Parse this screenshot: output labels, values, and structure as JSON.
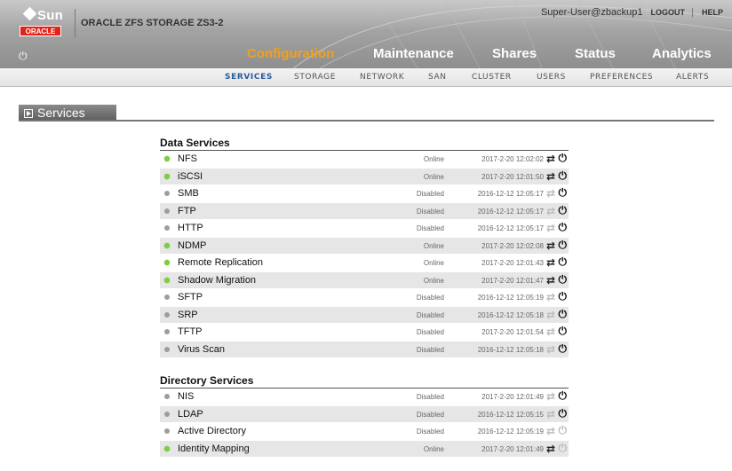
{
  "header": {
    "sun_logo": "Sun",
    "oracle_logo": "ORACLE",
    "product_name": "ORACLE ZFS STORAGE ZS3-2",
    "user": "Super-User@zbackup1",
    "logout": "LOGOUT",
    "help": "HELP",
    "power_icon": "power-icon"
  },
  "main_nav": {
    "tabs": [
      {
        "label": "Configuration",
        "active": true
      },
      {
        "label": "Maintenance",
        "active": false
      },
      {
        "label": "Shares",
        "active": false
      },
      {
        "label": "Status",
        "active": false
      },
      {
        "label": "Analytics",
        "active": false
      }
    ]
  },
  "sub_nav": {
    "tabs": [
      {
        "label": "SERVICES",
        "active": true
      },
      {
        "label": "STORAGE",
        "active": false
      },
      {
        "label": "NETWORK",
        "active": false
      },
      {
        "label": "SAN",
        "active": false
      },
      {
        "label": "CLUSTER",
        "active": false
      },
      {
        "label": "USERS",
        "active": false
      },
      {
        "label": "PREFERENCES",
        "active": false
      },
      {
        "label": "ALERTS",
        "active": false
      }
    ]
  },
  "section": {
    "title": "Services"
  },
  "colors": {
    "online": "#7bd13a",
    "disabled": "#9d9d9d",
    "active_tab": "#f2a01c",
    "oracle_red": "#e2231a"
  },
  "data_services": {
    "title": "Data Services",
    "rows": [
      {
        "name": "NFS",
        "status": "Online",
        "time": "2017-2-20 12:02:02",
        "online": true
      },
      {
        "name": "iSCSI",
        "status": "Online",
        "time": "2017-2-20 12:01:50",
        "online": true
      },
      {
        "name": "SMB",
        "status": "Disabled",
        "time": "2016-12-12 12:05:17",
        "online": false
      },
      {
        "name": "FTP",
        "status": "Disabled",
        "time": "2016-12-12 12:05:17",
        "online": false
      },
      {
        "name": "HTTP",
        "status": "Disabled",
        "time": "2016-12-12 12:05:17",
        "online": false
      },
      {
        "name": "NDMP",
        "status": "Online",
        "time": "2017-2-20 12:02:08",
        "online": true
      },
      {
        "name": "Remote Replication",
        "status": "Online",
        "time": "2017-2-20 12:01:43",
        "online": true
      },
      {
        "name": "Shadow Migration",
        "status": "Online",
        "time": "2017-2-20 12:01:47",
        "online": true
      },
      {
        "name": "SFTP",
        "status": "Disabled",
        "time": "2016-12-12 12:05:19",
        "online": false
      },
      {
        "name": "SRP",
        "status": "Disabled",
        "time": "2016-12-12 12:05:18",
        "online": false
      },
      {
        "name": "TFTP",
        "status": "Disabled",
        "time": "2017-2-20 12:01:54",
        "online": false
      },
      {
        "name": "Virus Scan",
        "status": "Disabled",
        "time": "2016-12-12 12:05:18",
        "online": false
      }
    ]
  },
  "directory_services": {
    "title": "Directory Services",
    "rows": [
      {
        "name": "NIS",
        "status": "Disabled",
        "time": "2017-2-20 12:01:49",
        "online": false
      },
      {
        "name": "LDAP",
        "status": "Disabled",
        "time": "2016-12-12 12:05:15",
        "online": false
      },
      {
        "name": "Active Directory",
        "status": "Disabled",
        "time": "2016-12-12 12:05:19",
        "online": false,
        "power_dim": true
      },
      {
        "name": "Identity Mapping",
        "status": "Online",
        "time": "2017-2-20 12:01:49",
        "online": true,
        "power_dim": true
      }
    ]
  }
}
